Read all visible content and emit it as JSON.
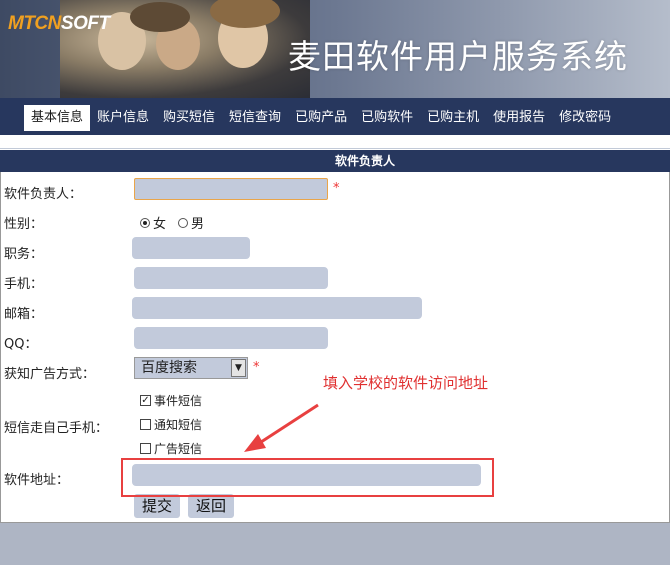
{
  "header": {
    "logo_part1": "MTCN",
    "logo_part2": "SOFT",
    "title": "麦田软件用户服务系统"
  },
  "nav": {
    "tabs": [
      {
        "label": "基本信息",
        "active": true
      },
      {
        "label": "账户信息"
      },
      {
        "label": "购买短信"
      },
      {
        "label": "短信查询"
      },
      {
        "label": "已购产品"
      },
      {
        "label": "已购软件"
      },
      {
        "label": "已购主机"
      },
      {
        "label": "使用报告"
      },
      {
        "label": "修改密码"
      }
    ]
  },
  "section": {
    "title": "软件负责人"
  },
  "form": {
    "responsible_label": "软件负责人：",
    "required_mark": "*",
    "gender_label": "性别：",
    "gender_female": "女",
    "gender_male": "男",
    "position_label": "职务：",
    "mobile_label": "手机：",
    "email_label": "邮箱：",
    "qq_label": "QQ：",
    "ad_source_label": "获知广告方式：",
    "ad_source_value": "百度搜索",
    "sms_label": "短信走自己手机：",
    "sms_options": [
      {
        "label": "事件短信",
        "checked": true
      },
      {
        "label": "通知短信",
        "checked": false
      },
      {
        "label": "广告短信",
        "checked": false
      }
    ],
    "software_url_label": "软件地址：",
    "submit_label": "提交",
    "back_label": "返回"
  },
  "annotation": {
    "text": "填入学校的软件访问地址",
    "color": "#e03030"
  },
  "colors": {
    "nav_bg": "#27375e",
    "input_bg": "#c2cadb",
    "footer_bg": "#aeb5c4"
  }
}
